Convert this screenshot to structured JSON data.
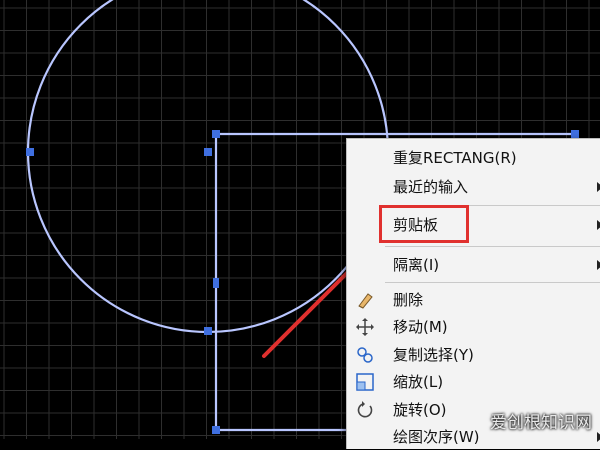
{
  "menu": {
    "items": [
      {
        "label": "重复RECTANG(R)",
        "submenu": false,
        "icon": ""
      },
      {
        "label": "最近的输入",
        "submenu": true,
        "icon": ""
      },
      {
        "label": "剪贴板",
        "submenu": true,
        "icon": "",
        "highlighted": true
      },
      {
        "label": "隔离(I)",
        "submenu": true,
        "icon": ""
      },
      {
        "label": "删除",
        "submenu": false,
        "icon": "eraser-icon"
      },
      {
        "label": "移动(M)",
        "submenu": false,
        "icon": "move-icon"
      },
      {
        "label": "复制选择(Y)",
        "submenu": false,
        "icon": "copy-selection-icon"
      },
      {
        "label": "缩放(L)",
        "submenu": false,
        "icon": "scale-icon"
      },
      {
        "label": "旋转(O)",
        "submenu": false,
        "icon": "rotate-icon"
      },
      {
        "label": "绘图次序(W)",
        "submenu": true,
        "icon": ""
      }
    ]
  },
  "watermark": "爱创根知识网",
  "colors": {
    "background": "#000000",
    "grid": "#2e2e2e",
    "geometry": "#b9c6ff",
    "grip": "#3f6fe0",
    "annotation": "#e0302e"
  }
}
